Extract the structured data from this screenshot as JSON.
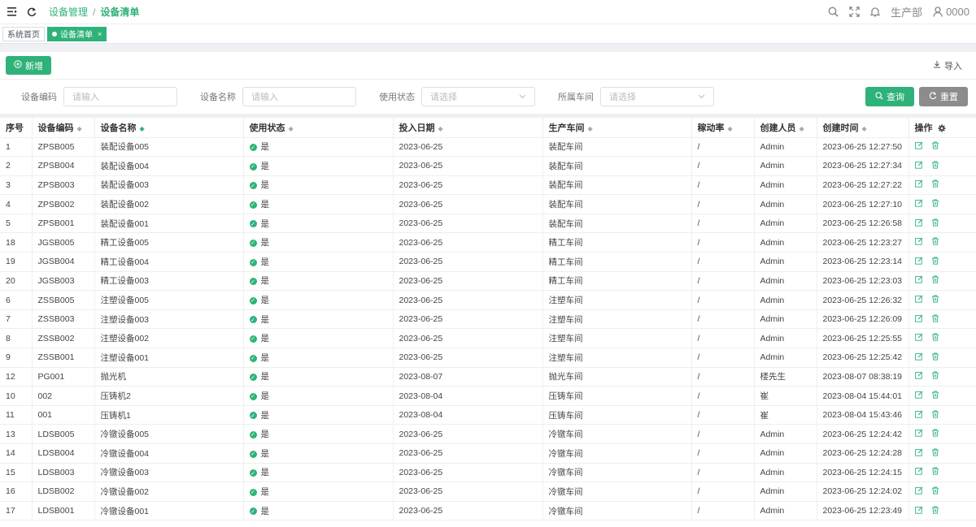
{
  "header": {
    "breadcrumb_parent": "设备管理",
    "breadcrumb_sep": "/",
    "breadcrumb_current": "设备清单",
    "org": "生产部",
    "user": "0000"
  },
  "tabs": [
    {
      "label": "系统首页"
    },
    {
      "label": "设备清单"
    }
  ],
  "toolbar": {
    "add_label": "新增",
    "import_label": "导入"
  },
  "filters": [
    {
      "label": "设备编码",
      "placeholder": "请输入"
    },
    {
      "label": "设备名称",
      "placeholder": "请输入"
    },
    {
      "label": "使用状态",
      "placeholder": "请选择"
    },
    {
      "label": "所属车间",
      "placeholder": "请选择"
    }
  ],
  "buttons": {
    "query": "查询",
    "reset": "重置"
  },
  "table": {
    "columns": [
      "序号",
      "设备编码",
      "设备名称",
      "使用状态",
      "投入日期",
      "生产车间",
      "稼动率",
      "创建人员",
      "创建时间",
      "操作"
    ],
    "rows": [
      [
        "1",
        "ZPSB005",
        "装配设备005",
        "是",
        "2023-06-25",
        "装配车间",
        "/",
        "Admin",
        "2023-06-25 12:27:50"
      ],
      [
        "2",
        "ZPSB004",
        "装配设备004",
        "是",
        "2023-06-25",
        "装配车间",
        "/",
        "Admin",
        "2023-06-25 12:27:34"
      ],
      [
        "3",
        "ZPSB003",
        "装配设备003",
        "是",
        "2023-06-25",
        "装配车间",
        "/",
        "Admin",
        "2023-06-25 12:27:22"
      ],
      [
        "4",
        "ZPSB002",
        "装配设备002",
        "是",
        "2023-06-25",
        "装配车间",
        "/",
        "Admin",
        "2023-06-25 12:27:10"
      ],
      [
        "5",
        "ZPSB001",
        "装配设备001",
        "是",
        "2023-06-25",
        "装配车间",
        "/",
        "Admin",
        "2023-06-25 12:26:58"
      ],
      [
        "18",
        "JGSB005",
        "精工设备005",
        "是",
        "2023-06-25",
        "精工车间",
        "/",
        "Admin",
        "2023-06-25 12:23:27"
      ],
      [
        "19",
        "JGSB004",
        "精工设备004",
        "是",
        "2023-06-25",
        "精工车间",
        "/",
        "Admin",
        "2023-06-25 12:23:14"
      ],
      [
        "20",
        "JGSB003",
        "精工设备003",
        "是",
        "2023-06-25",
        "精工车间",
        "/",
        "Admin",
        "2023-06-25 12:23:03"
      ],
      [
        "6",
        "ZSSB005",
        "注塑设备005",
        "是",
        "2023-06-25",
        "注塑车间",
        "/",
        "Admin",
        "2023-06-25 12:26:32"
      ],
      [
        "7",
        "ZSSB003",
        "注塑设备003",
        "是",
        "2023-06-25",
        "注塑车间",
        "/",
        "Admin",
        "2023-06-25 12:26:09"
      ],
      [
        "8",
        "ZSSB002",
        "注塑设备002",
        "是",
        "2023-06-25",
        "注塑车间",
        "/",
        "Admin",
        "2023-06-25 12:25:55"
      ],
      [
        "9",
        "ZSSB001",
        "注塑设备001",
        "是",
        "2023-06-25",
        "注塑车间",
        "/",
        "Admin",
        "2023-06-25 12:25:42"
      ],
      [
        "12",
        "PG001",
        "抛光机",
        "是",
        "2023-08-07",
        "抛光车间",
        "/",
        "楼先生",
        "2023-08-07 08:38:19"
      ],
      [
        "10",
        "002",
        "压铸机2",
        "是",
        "2023-08-04",
        "压铸车间",
        "/",
        "崔",
        "2023-08-04 15:44:01"
      ],
      [
        "11",
        "001",
        "压铸机1",
        "是",
        "2023-08-04",
        "压铸车间",
        "/",
        "崔",
        "2023-08-04 15:43:46"
      ],
      [
        "13",
        "LDSB005",
        "冷镦设备005",
        "是",
        "2023-06-25",
        "冷镦车间",
        "/",
        "Admin",
        "2023-06-25 12:24:42"
      ],
      [
        "14",
        "LDSB004",
        "冷镦设备004",
        "是",
        "2023-06-25",
        "冷镦车间",
        "/",
        "Admin",
        "2023-06-25 12:24:28"
      ],
      [
        "15",
        "LDSB003",
        "冷镦设备003",
        "是",
        "2023-06-25",
        "冷镦车间",
        "/",
        "Admin",
        "2023-06-25 12:24:15"
      ],
      [
        "16",
        "LDSB002",
        "冷镦设备002",
        "是",
        "2023-06-25",
        "冷镦车间",
        "/",
        "Admin",
        "2023-06-25 12:24:02"
      ],
      [
        "17",
        "LDSB001",
        "冷镦设备001",
        "是",
        "2023-06-25",
        "冷镦车间",
        "/",
        "Admin",
        "2023-06-25 12:23:49"
      ]
    ]
  },
  "colors": {
    "accent": "#2fb27a",
    "reset": "#8c8c8c"
  }
}
